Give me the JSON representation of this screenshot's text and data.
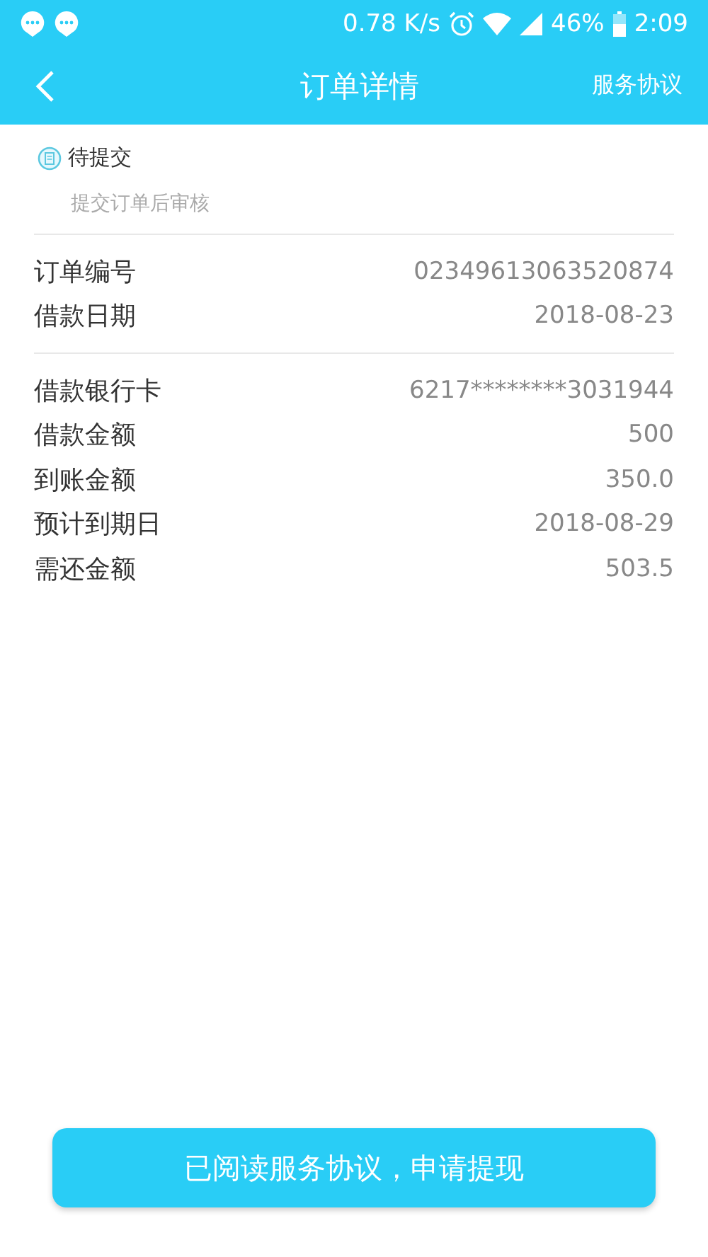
{
  "status_bar": {
    "network_speed": "0.78 K/s",
    "battery": "46%",
    "time": "2:09"
  },
  "header": {
    "title": "订单详情",
    "action": "服务协议"
  },
  "order_status": {
    "label": "待提交",
    "hint": "提交订单后审核"
  },
  "sections": [
    {
      "rows": [
        {
          "label": "订单编号",
          "value": "02349613063520874"
        },
        {
          "label": "借款日期",
          "value": "2018-08-23"
        }
      ]
    },
    {
      "rows": [
        {
          "label": "借款银行卡",
          "value": "6217********3031944"
        },
        {
          "label": "借款金额",
          "value": "500"
        },
        {
          "label": "到账金额",
          "value": "350.0"
        },
        {
          "label": "预计到期日",
          "value": "2018-08-29"
        },
        {
          "label": "需还金额",
          "value": "503.5"
        }
      ]
    }
  ],
  "submit_button": "已阅读服务协议，申请提现"
}
